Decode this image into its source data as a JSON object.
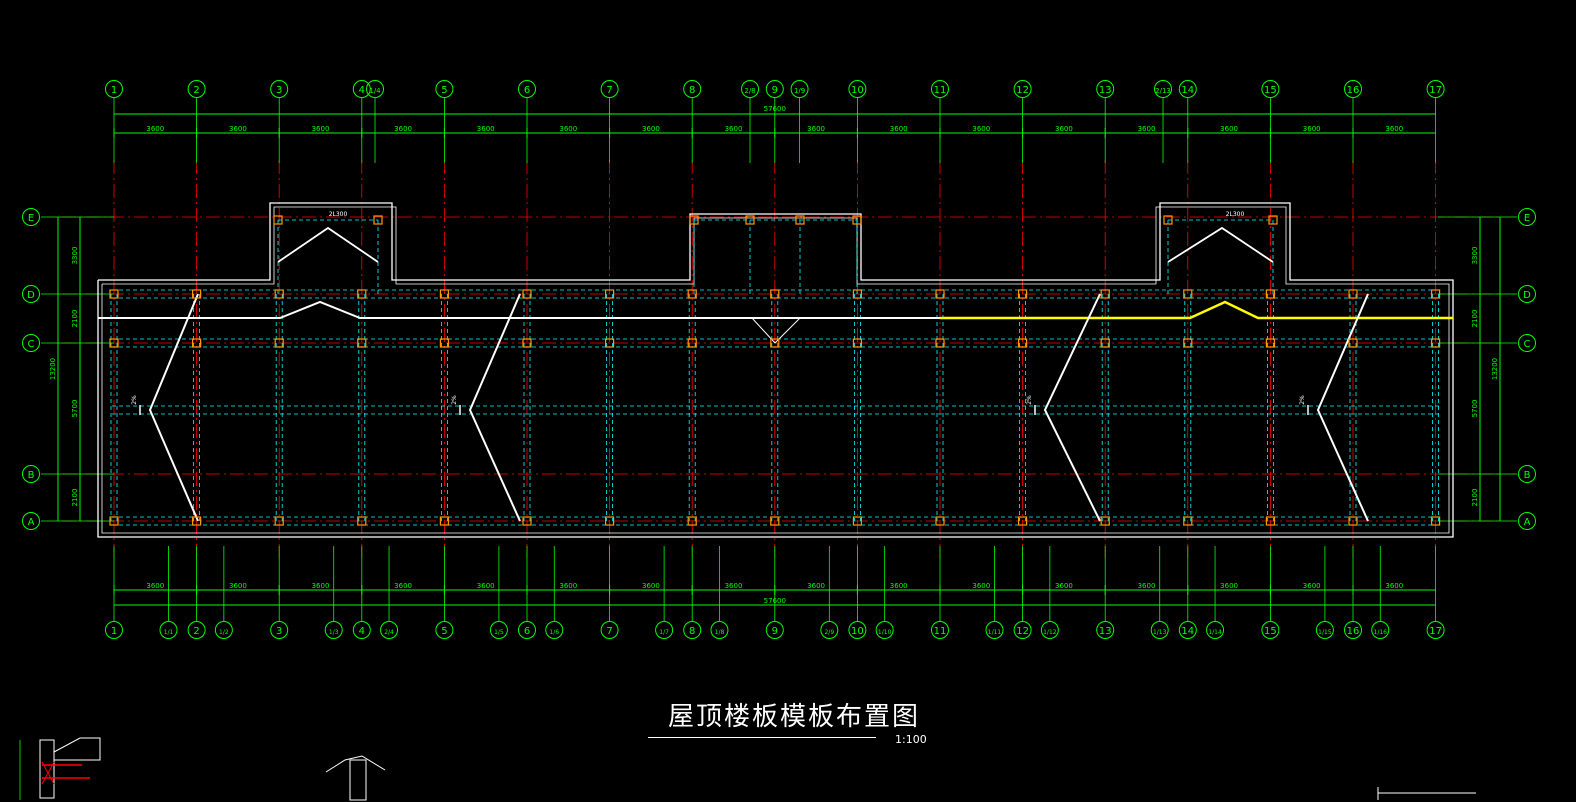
{
  "drawing_title": "屋顶楼板模板布置图",
  "scale": "1:100",
  "colors": {
    "background": "#000000",
    "axis_green": "#00ff00",
    "axis_red": "#ff0000",
    "dashed_cyan": "#00ffff",
    "column_orange": "#ff9900",
    "highlight_yellow": "#ffff00",
    "wall_white": "#ffffff"
  },
  "top_axes": [
    "1",
    "2",
    "3",
    "4",
    "1/4",
    "5",
    "6",
    "7",
    "8",
    "2/8",
    "9",
    "1/9",
    "10",
    "11",
    "12",
    "13",
    "2/13",
    "14",
    "15",
    "16",
    "17"
  ],
  "bottom_axes": [
    "1",
    "1/1",
    "2",
    "1/2",
    "3",
    "1/3",
    "4",
    "2/4",
    "5",
    "1/5",
    "6",
    "1/6",
    "7",
    "1/7",
    "8",
    "1/8",
    "9",
    "2/9",
    "10",
    "1/10",
    "11",
    "1/11",
    "12",
    "1/12",
    "13",
    "1/13",
    "14",
    "1/14",
    "15",
    "1/15",
    "16",
    "1/16",
    "17"
  ],
  "row_axes": [
    "E",
    "D",
    "C",
    "B",
    "A"
  ],
  "bay_dims": [
    "3600",
    "3600",
    "3600",
    "3600",
    "3600",
    "3600",
    "3600",
    "3600",
    "3600",
    "3600",
    "3600",
    "3600",
    "3600",
    "3600",
    "3600",
    "3600"
  ],
  "total_length": "57600",
  "vertical_dims": [
    "3300",
    "2100",
    "5700",
    "2100"
  ],
  "total_height": "13200",
  "annotations": {
    "stair_label": "2L300",
    "slope_label": "2%"
  }
}
